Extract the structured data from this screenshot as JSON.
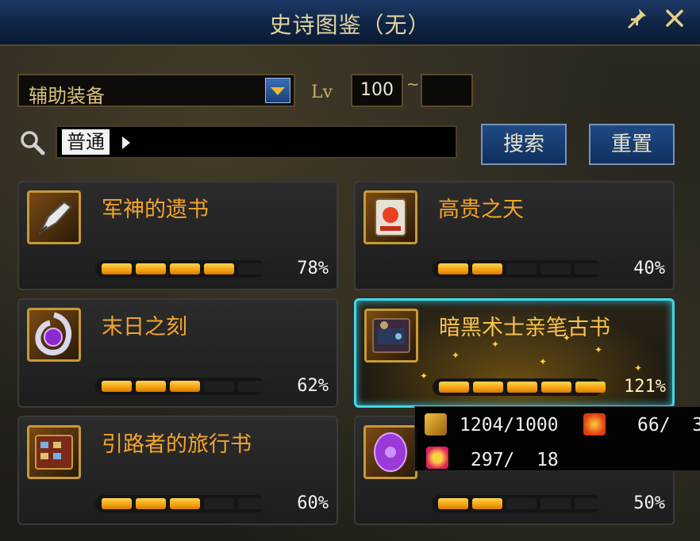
{
  "window": {
    "title": "史诗图鉴（无）"
  },
  "filter": {
    "category": "辅助装备",
    "lv_label": "Lv",
    "lv_min": "100",
    "lv_separator": "~",
    "lv_max": ""
  },
  "search": {
    "value": "普通",
    "search_button": "搜索",
    "reset_button": "重置"
  },
  "items": [
    {
      "name": "军神的遗书",
      "progress_text": "78%",
      "progress": 0.78,
      "segments_filled": 4,
      "icon": "golden-pen-icon",
      "selected": false
    },
    {
      "name": "高贵之天",
      "progress_text": "40%",
      "progress": 0.4,
      "segments_filled": 2,
      "icon": "red-card-icon",
      "selected": false
    },
    {
      "name": "末日之刻",
      "progress_text": "62%",
      "progress": 0.62,
      "segments_filled": 3,
      "icon": "purple-gem-icon",
      "selected": false
    },
    {
      "name": "暗黑术士亲笔古书",
      "progress_text": "121%",
      "progress": 1.21,
      "segments_filled": 5,
      "icon": "dark-book-icon",
      "selected": true
    },
    {
      "name": "引路者的旅行书",
      "progress_text": "60%",
      "progress": 0.6,
      "segments_filled": 3,
      "icon": "travel-book-icon",
      "selected": false
    },
    {
      "name": "",
      "progress_text": "50%",
      "progress": 0.5,
      "segments_filled": 2,
      "icon": "purple-stone-icon",
      "selected": false
    }
  ],
  "tooltip": {
    "values": [
      "1204/1000",
      "66/  3",
      "297/  18"
    ],
    "icons": [
      "gold-wings-icon",
      "red-flame-icon",
      "red-orb-icon"
    ]
  },
  "colors": {
    "title_bar": "#0f2444",
    "item_name": "#f3a52a",
    "progress_fill": "#f4a10e",
    "selected_border": "#40d8e8"
  }
}
